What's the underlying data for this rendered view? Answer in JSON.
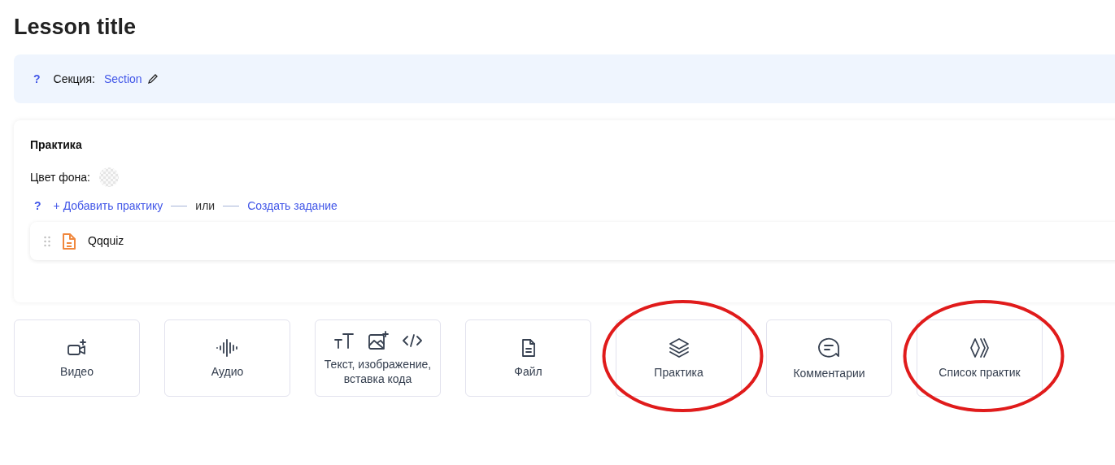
{
  "title": "Lesson title",
  "section": {
    "help": "?",
    "label": "Секция:",
    "value": "Section"
  },
  "practice": {
    "heading": "Практика",
    "bg_label": "Цвет фона:",
    "help": "?",
    "add_link": "+ Добавить практику",
    "or": "или",
    "create_link": "Создать задание",
    "items": [
      {
        "name": "Qqquiz"
      }
    ]
  },
  "tiles": [
    {
      "kind": "video",
      "label": "Видео",
      "circled": false
    },
    {
      "kind": "audio",
      "label": "Аудио",
      "circled": false
    },
    {
      "kind": "rich",
      "label": "Текст, изображение, вставка кода",
      "circled": false
    },
    {
      "kind": "file",
      "label": "Файл",
      "circled": false
    },
    {
      "kind": "practice",
      "label": "Практика",
      "circled": true
    },
    {
      "kind": "comments",
      "label": "Комментарии",
      "circled": false
    },
    {
      "kind": "list",
      "label": "Список практик",
      "circled": true
    }
  ]
}
